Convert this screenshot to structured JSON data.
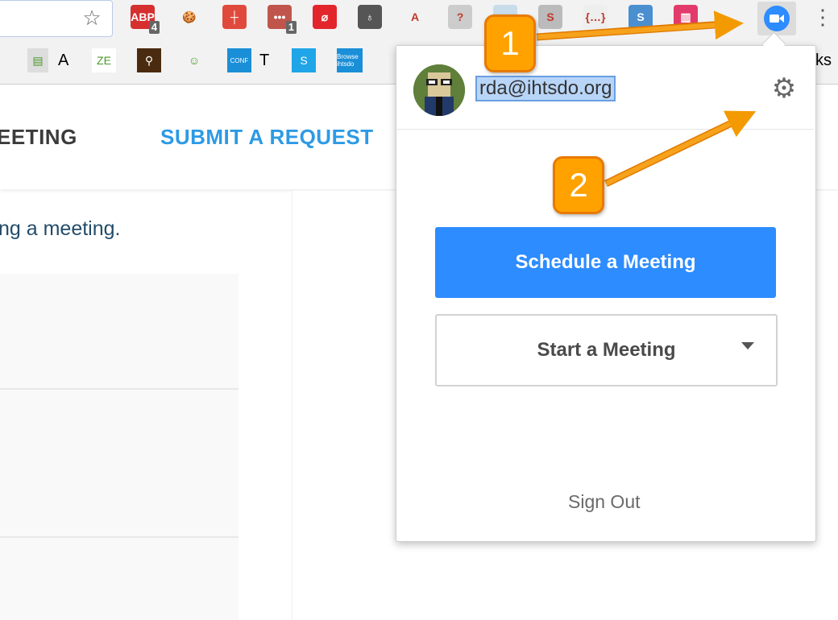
{
  "browser": {
    "extensions": [
      {
        "name": "adblock-ext-icon",
        "label": "ABP",
        "badge": "4",
        "color": "#d62f2f"
      },
      {
        "name": "cookie-ext-icon",
        "label": "🍪",
        "badge": "",
        "color": "#f2f2f2"
      },
      {
        "name": "clock-ext-icon",
        "label": "┼",
        "badge": "",
        "color": "#e04a3c"
      },
      {
        "name": "dots-ext-icon",
        "label": "•••",
        "badge": "1",
        "color": "#c0554c"
      },
      {
        "name": "authy-ext-icon",
        "label": "⌀",
        "badge": "",
        "color": "#e2262c"
      },
      {
        "name": "bulb-ext-icon",
        "label": "♁",
        "badge": "",
        "color": "#555555"
      },
      {
        "name": "font-ext-icon",
        "label": "A",
        "badge": "",
        "color": "#f2f2f2"
      },
      {
        "name": "help-ext-icon",
        "label": "?",
        "badge": "",
        "color": "#cccccc"
      },
      {
        "name": "globe-ext-icon",
        "label": "",
        "badge": "",
        "color": "#c8dce9"
      },
      {
        "name": "skype-gray-ext-icon",
        "label": "S",
        "badge": "",
        "color": "#bbbbbb"
      },
      {
        "name": "json-ext-icon",
        "label": "{…}",
        "badge": "",
        "color": "#eeeeee"
      },
      {
        "name": "s-ext-icon",
        "label": "S",
        "badge": "",
        "color": "#4a8fd0"
      },
      {
        "name": "calendar-ext-icon",
        "label": "▥",
        "badge": "",
        "color": "#e23b6b"
      }
    ],
    "bookmarks": [
      {
        "name": "bookmark-doc-icon",
        "label": "▤",
        "color": "#ddd"
      },
      {
        "name": "bookmark-ze-icon",
        "label": "ZE",
        "color": "#fff"
      },
      {
        "name": "bookmark-search-icon",
        "label": "⚲",
        "color": "#4a2b10"
      },
      {
        "name": "bookmark-geek-icon",
        "label": "☺",
        "color": "#f2f2f2"
      },
      {
        "name": "bookmark-conf-icon",
        "label": "CONF",
        "color": "#1a8fd8"
      },
      {
        "name": "bookmark-skype-icon",
        "label": "S",
        "color": "#1fa5e8"
      },
      {
        "name": "bookmark-browse-icon",
        "label": "Browse ihtsdo",
        "color": "#1a8fd8"
      }
    ],
    "bookmark_texts": {
      "a": "A",
      "t": "T",
      "ks": "ks"
    }
  },
  "page": {
    "nav_meeting": "EETING",
    "nav_submit": "SUBMIT A REQUEST",
    "body_text": "ng a meeting."
  },
  "popup": {
    "email": "rda@ihtsdo.org",
    "schedule_label": "Schedule a Meeting",
    "start_label": "Start a Meeting",
    "sign_out_label": "Sign Out"
  },
  "callouts": {
    "one": "1",
    "two": "2"
  },
  "colors": {
    "zoom_blue": "#2d8cff",
    "callout_orange": "#ffa200",
    "link_blue": "#2d9ae6"
  }
}
